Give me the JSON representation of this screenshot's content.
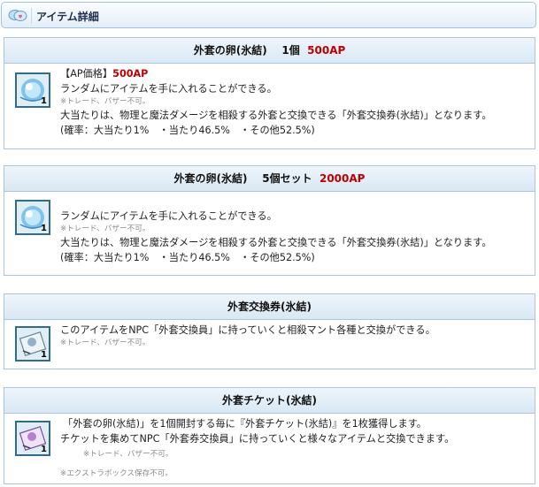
{
  "header": {
    "title": "アイテム詳細",
    "icon": "heart-speech-bubble-icon"
  },
  "colors": {
    "accent_red": "#c00000",
    "border": "#a9c6dc",
    "note_gray": "#8a8a8a"
  },
  "items": [
    {
      "title_name": "外套の卵(氷結)",
      "title_qty": "1個",
      "title_price": "500AP",
      "icon": "ice-egg-icon",
      "icon_count": "1",
      "price_label": "【AP価格】",
      "price_value": "500AP",
      "line1": "ランダムにアイテムを手に入れることができる。",
      "note": "※トレード、バザー不可。",
      "line2": "大当たりは、物理と魔法ダメージを相殺する外套と交換できる「外套交換券(氷結)」となります。",
      "line3": "(確率：大当たり1%　・当たり46.5%　・その他52.5%)"
    },
    {
      "title_name": "外套の卵(氷結)",
      "title_qty": "5個セット",
      "title_price": "2000AP",
      "icon": "ice-egg-icon",
      "icon_count": "1",
      "line1": "ランダムにアイテムを手に入れることができる。",
      "note": "※トレード、バザー不可。",
      "line2": "大当たりは、物理と魔法ダメージを相殺する外套と交換できる「外套交換券(氷結)」となります。",
      "line3": "(確率：大当たり1%　・当たり46.5%　・その他52.5%)"
    },
    {
      "title_name": "外套交換券(氷結)",
      "icon": "scroll-ticket-icon",
      "icon_count": "1",
      "line1": "このアイテムをNPC「外套交換員」に持っていくと相殺マント各種と交換ができる。",
      "note": "※トレード、バザー不可。"
    },
    {
      "title_name": "外套チケット(氷結)",
      "icon": "purple-scroll-ticket-icon",
      "icon_count": "1",
      "line1": "「外套の卵(氷結)」を1個開封する毎に『外套チケット(氷結)』を1枚獲得します。",
      "line2": "チケットを集めてNPC「外套券交換員」に持っていくと様々なアイテムと交換できます。",
      "note": "※トレード、バザー不可。",
      "note2": "※エクストラボックス保存不可。"
    }
  ]
}
